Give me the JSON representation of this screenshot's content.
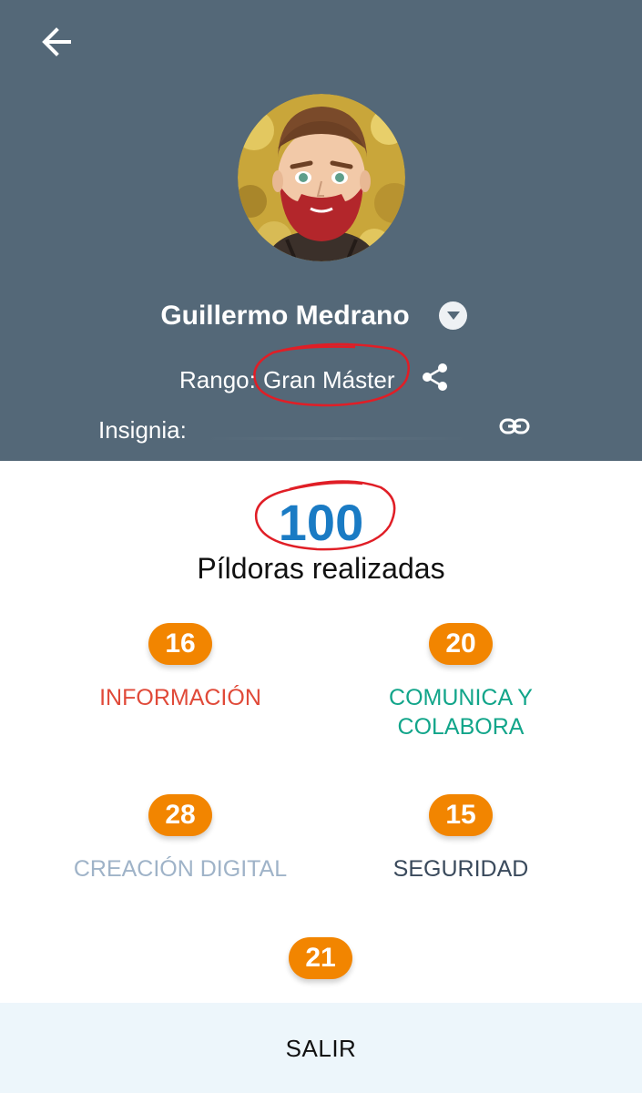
{
  "header": {
    "background_color": "#546878",
    "back_icon": "arrow-left-icon",
    "user_name": "Guillermo Medrano",
    "dropdown_icon": "chevron-down-icon",
    "rank_label": "Rango:",
    "rank_value": "Gran Máster",
    "share_icon": "share-icon",
    "badge_label": "Insignia:",
    "link_icon": "link-icon"
  },
  "summary": {
    "total": "100",
    "total_label": "Píldoras realizadas",
    "total_color": "#1a7bc4",
    "annotation_color": "#e01e26"
  },
  "categories": [
    {
      "count": "16",
      "label": "INFORMACIÓN",
      "color": "#e04a39"
    },
    {
      "count": "20",
      "label": "COMUNICA Y COLABORA",
      "color": "#12a58a"
    },
    {
      "count": "28",
      "label": "CREACIÓN DIGITAL",
      "color": "#9fb3c8"
    },
    {
      "count": "15",
      "label": "SEGURIDAD",
      "color": "#3a4a5c"
    },
    {
      "count": "21",
      "label": "",
      "color": "#f28500"
    }
  ],
  "footer": {
    "exit_label": "SALIR"
  }
}
